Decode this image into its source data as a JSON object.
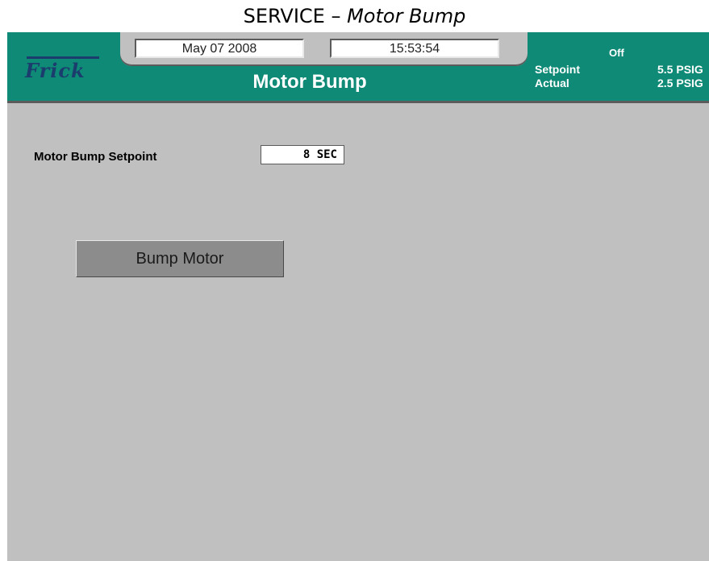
{
  "doc": {
    "title_main": "SERVICE – ",
    "title_sub": "Motor Bump"
  },
  "header": {
    "logo_text": "Frick",
    "date": "May 07 2008",
    "time": "15:53:54",
    "screen_title": "Motor Bump",
    "status": "Off",
    "setpoint_label": "Setpoint",
    "setpoint_value": "5.5 PSIG",
    "actual_label": "Actual",
    "actual_value": "2.5 PSIG"
  },
  "main": {
    "setpoint_label": "Motor Bump Setpoint",
    "setpoint_value": "8 SEC",
    "bump_button_label": "Bump Motor"
  },
  "colors": {
    "header_bg": "#0f8a76",
    "screen_bg": "#c0c0c0",
    "logo": "#1a3d6e",
    "button_bg": "#8c8c8c"
  }
}
